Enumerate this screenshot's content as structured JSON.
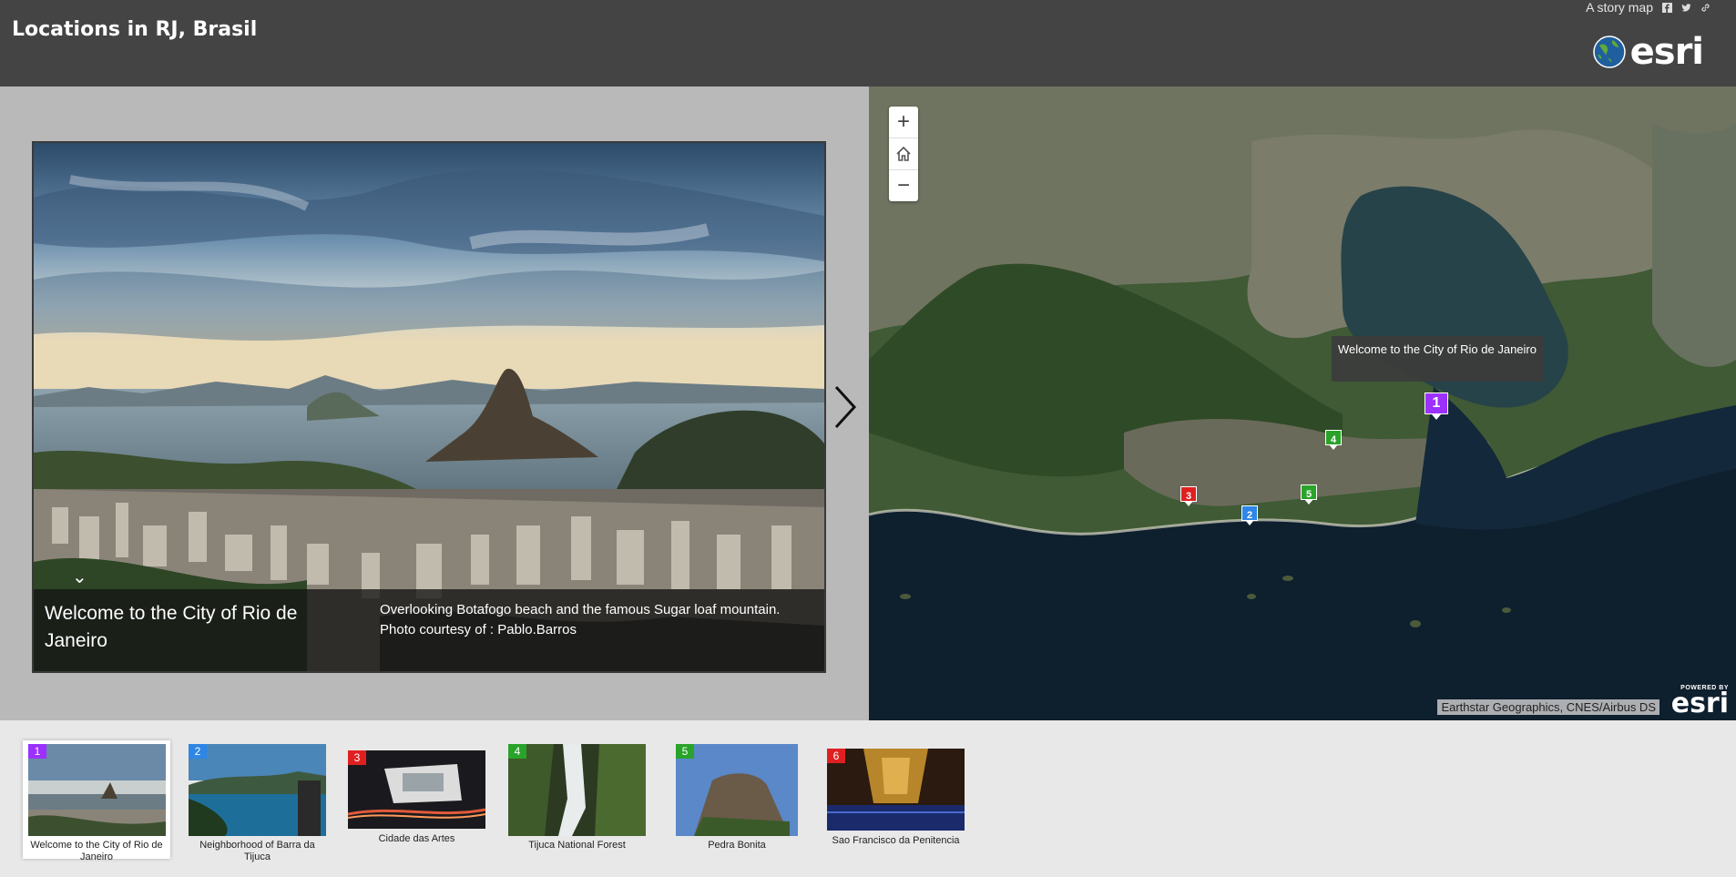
{
  "header": {
    "title": "Locations in RJ, Brasil",
    "storymap_label": "A story map",
    "social_icons": [
      "facebook-icon",
      "twitter-icon",
      "link-icon"
    ],
    "logo_text": "esri"
  },
  "media": {
    "caption_title": "Welcome to the City of Rio de Janeiro",
    "caption_desc_line1": "Overlooking Botafogo beach and the famous Sugar loaf mountain.",
    "caption_desc_line2": "Photo courtesy of : Pablo.Barros",
    "toggle_icon": "chevron-down-icon",
    "next_icon": "chevron-right-icon"
  },
  "map": {
    "zoom_in": "+",
    "zoom_out": "−",
    "home_icon": "home-icon",
    "tooltip": "Welcome to the City of Rio de Janeiro",
    "attribution": "Earthstar Geographics, CNES/Airbus DS",
    "powered_by": "POWERED BY",
    "powered_logo": "esri",
    "pins": [
      {
        "num": "1",
        "color": "#9b30ff"
      },
      {
        "num": "2",
        "color": "#2e86e6"
      },
      {
        "num": "3",
        "color": "#e02020"
      },
      {
        "num": "4",
        "color": "#2aa32a"
      },
      {
        "num": "5",
        "color": "#2aa32a"
      }
    ]
  },
  "thumbnails": [
    {
      "num": "1",
      "label": "Welcome to the City of Rio de Janeiro",
      "color": "#9b30ff"
    },
    {
      "num": "2",
      "label": "Neighborhood of Barra da Tijuca",
      "color": "#2e86e6"
    },
    {
      "num": "3",
      "label": "Cidade das Artes",
      "color": "#e02020"
    },
    {
      "num": "4",
      "label": "Tijuca National Forest",
      "color": "#2aa32a"
    },
    {
      "num": "5",
      "label": "Pedra Bonita",
      "color": "#2aa32a"
    },
    {
      "num": "6",
      "label": "Sao Francisco da Penitencia",
      "color": "#e02020"
    }
  ]
}
